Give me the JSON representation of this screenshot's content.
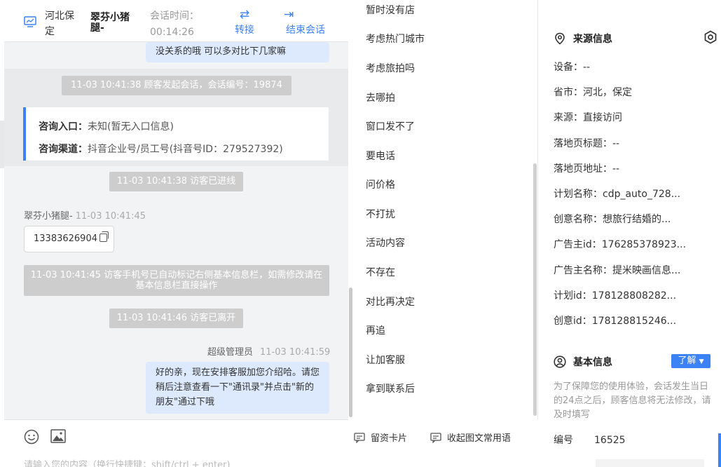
{
  "header": {
    "location": "河北保定",
    "customer_name": "翠芬小猪腿-",
    "session_time_label": "会话时间：",
    "session_time_value": "00:14:26",
    "transfer_label": "转接",
    "end_label": "结束会话"
  },
  "chat": {
    "top_bubble": "没关系的哦 可以多对比下几家嘛",
    "session_start": "11-03 10:41:38 顾客发起会话，会话编号：19874",
    "entry_label": "咨询入口：",
    "entry_value": "未知(暂无入口信息)",
    "channel_label": "咨询渠道：",
    "channel_value": "抖音企业号/员工号(抖音号ID：279527392)",
    "visitor_entered": "11-03 10:41:38 访客已进线",
    "visitor_sender": "翠芬小猪腿-",
    "visitor_time": "11-03 10:41:45",
    "phone": "13383626904",
    "auto_mark": "11-03 10:41:45 访客手机号已自动标记右侧基本信息栏，如需修改请在基本信息栏直接操作",
    "visitor_left": "11-03 10:41:46 访客已离开",
    "admin_sender": "超级管理员",
    "admin_time": "11-03 10:41:59",
    "admin_message": "好的亲，现在安排客服加您介绍哈。请您稍后注意查看一下\"通讯录\"并点击\"新的朋友\"通过下哦"
  },
  "input": {
    "placeholder": "请输入您的内容（换行快捷键：shift/ctrl + enter)"
  },
  "quick_replies": [
    "暂时没有店",
    "考虑热门城市",
    "考虑旅拍吗",
    "去哪拍",
    "窗口发不了",
    "要电话",
    "问价格",
    "不打扰",
    "活动内容",
    "不存在",
    "对比再决定",
    "再追",
    "让加客服",
    "拿到联系后"
  ],
  "quick_footer": {
    "card_label": "留资卡片",
    "collect_label": "收起图文常用语"
  },
  "source_info": {
    "title": "来源信息",
    "fields": [
      "设备：--",
      "省市：河北，保定",
      "来源：直接访问",
      "落地页标题：--",
      "落地页地址：--",
      "计划名称：cdp_auto_728...",
      "创意名称：想旅行结婚的...",
      "广告主id：176285378923...",
      "广告主名称：提米映画信息...",
      "计划id：178128808282...",
      "创意id：178128815246..."
    ]
  },
  "basic_info": {
    "title": "基本信息",
    "learn_label": "了解",
    "note": "为了保障您的使用体验，会话发生当日的24点之后，顾客信息将无法修改，请及时填写",
    "number_label": "编号",
    "number_value": "16525"
  },
  "colors": {
    "accent": "#3b82f6",
    "bubble": "#dde9fd",
    "system_chip": "#cdcdcd"
  }
}
